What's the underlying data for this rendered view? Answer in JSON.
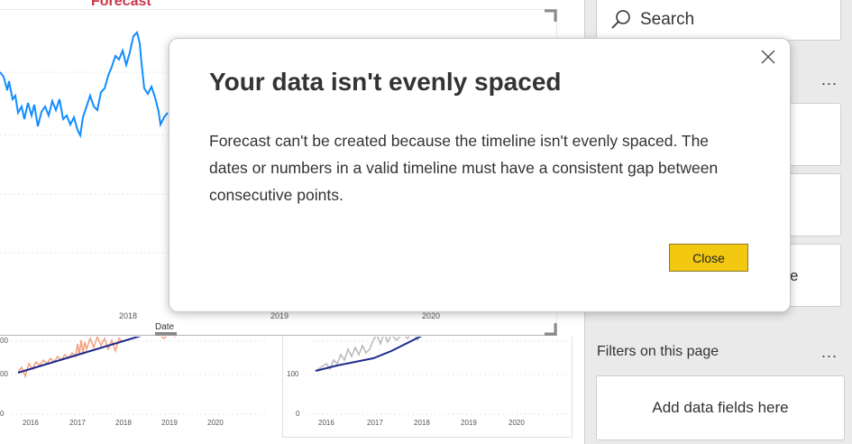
{
  "canvas": {
    "forecast_title": "Forecast",
    "top_axis_ticks": [
      "2018",
      "2019",
      "2020"
    ],
    "top_axis_label": "Date",
    "left_chart": {
      "y_ticks": [
        "00",
        "00",
        "0"
      ],
      "x_ticks": [
        "2016",
        "2017",
        "2018",
        "2019",
        "2020"
      ]
    },
    "right_chart": {
      "y_ticks": [
        "100",
        "0"
      ],
      "x_ticks": [
        "2016",
        "2017",
        "2018",
        "2019",
        "2020"
      ]
    }
  },
  "right_pane": {
    "search_placeholder": "Search",
    "more_label": "...",
    "partial_text": "e",
    "filters_title": "Filters on this page",
    "add_fields_label": "Add data fields here"
  },
  "dialog": {
    "title": "Your data isn't evenly spaced",
    "body": "Forecast can't be created because the timeline isn't evenly spaced. The dates or numbers in a valid timeline must have a consistent gap between consecutive points.",
    "close_button": "Close"
  }
}
